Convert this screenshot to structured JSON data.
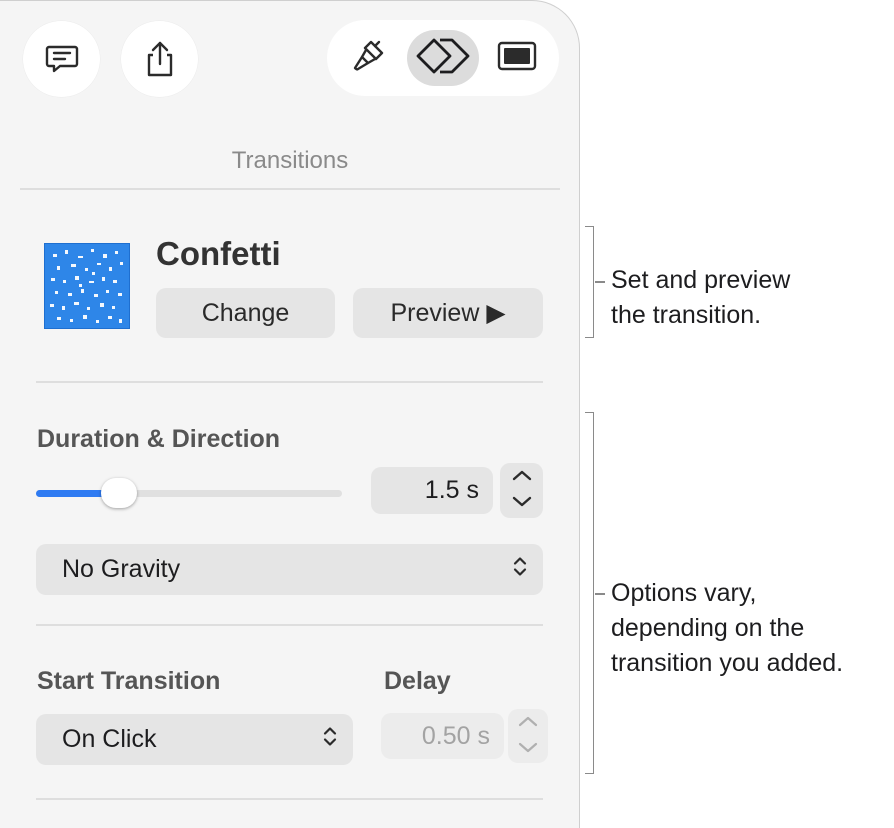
{
  "toolbar": {
    "comment_icon": "comment-bubble-icon",
    "share_icon": "share-icon",
    "format_icon": "paintbrush-icon",
    "animate_icon": "animate-diamond-icon",
    "document_icon": "document-icon"
  },
  "inspector": {
    "section_title": "Transitions",
    "transition": {
      "name": "Confetti",
      "change_label": "Change",
      "preview_label": "Preview ▶"
    },
    "duration": {
      "label": "Duration & Direction",
      "value": "1.5 s",
      "slider_fraction": 0.27,
      "direction": "No Gravity"
    },
    "start": {
      "label": "Start Transition",
      "value": "On Click",
      "delay_label": "Delay",
      "delay_value": "0.50 s"
    }
  },
  "callouts": {
    "set_preview": [
      "Set and preview",
      "the transition."
    ],
    "options": [
      "Options vary,",
      "depending on the",
      "transition you added."
    ]
  },
  "colors": {
    "accent": "#2f7bf2",
    "thumb": "#2e86e8",
    "panel": "#f5f5f5"
  }
}
